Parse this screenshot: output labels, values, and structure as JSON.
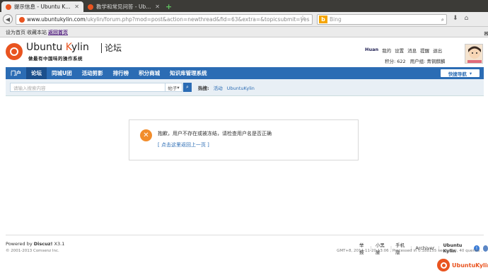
{
  "browser": {
    "tabs": [
      {
        "title": "提示信息 - Ubuntu K...",
        "active": true
      },
      {
        "title": "教学和常见问答 - Ub...",
        "active": false
      }
    ],
    "url_host": "www.ubuntukylin.com",
    "url_path": "/ukylin/forum.php?mod=post&action=newthread&fid=63&extra=&topicsubmit=yes",
    "search_placeholder": "Bing",
    "bookmarks": [
      "设为首页",
      "收藏本站",
      "返回首页"
    ]
  },
  "header": {
    "logo_ubuntu": "Ubuntu ",
    "logo_k": "K",
    "logo_ylin": "ylin",
    "logo_forum": "论坛",
    "tagline": "做最有中国味的操作系统",
    "user": {
      "name": "Huan",
      "links": [
        "我的",
        "设置",
        "消息",
        "提醒",
        "退出"
      ],
      "points_label": "积分: 622",
      "group_label": "用户组: 青铜麒麟"
    }
  },
  "mainnav": {
    "items": [
      "门户",
      "论坛",
      "同城U团",
      "活动剪影",
      "排行榜",
      "积分商城",
      "知识库管理系统"
    ],
    "active_index": 1,
    "quicknav": "快捷导航"
  },
  "subbar": {
    "search_placeholder": "请输入搜索内容",
    "search_type": "帖子",
    "hot_label": "热搜:",
    "hot_links": [
      "活动",
      "UbuntuKylin"
    ]
  },
  "message": {
    "text": "抱歉，用户不存在或被冻结，请检查用户名是否正确",
    "back_link": "[ 点击这里返回上一页 ]"
  },
  "footer": {
    "powered_prefix": "Powered by ",
    "powered_name": "Discuz!",
    "powered_version": " X3.1",
    "copyright": "© 2001-2013 Comsenz Inc.",
    "links": [
      "举报",
      "小黑屋",
      "手机版",
      "Archiver",
      "Ubuntu Kylin"
    ],
    "stats": "GMT+8, 2014-11-20 13:06 , Processed in 0.188155 second(s), 40 queries .",
    "corner_brand": "UbuntuKylin"
  },
  "colors": {
    "brand_orange": "#e95420",
    "nav_blue": "#2b6cb4"
  }
}
